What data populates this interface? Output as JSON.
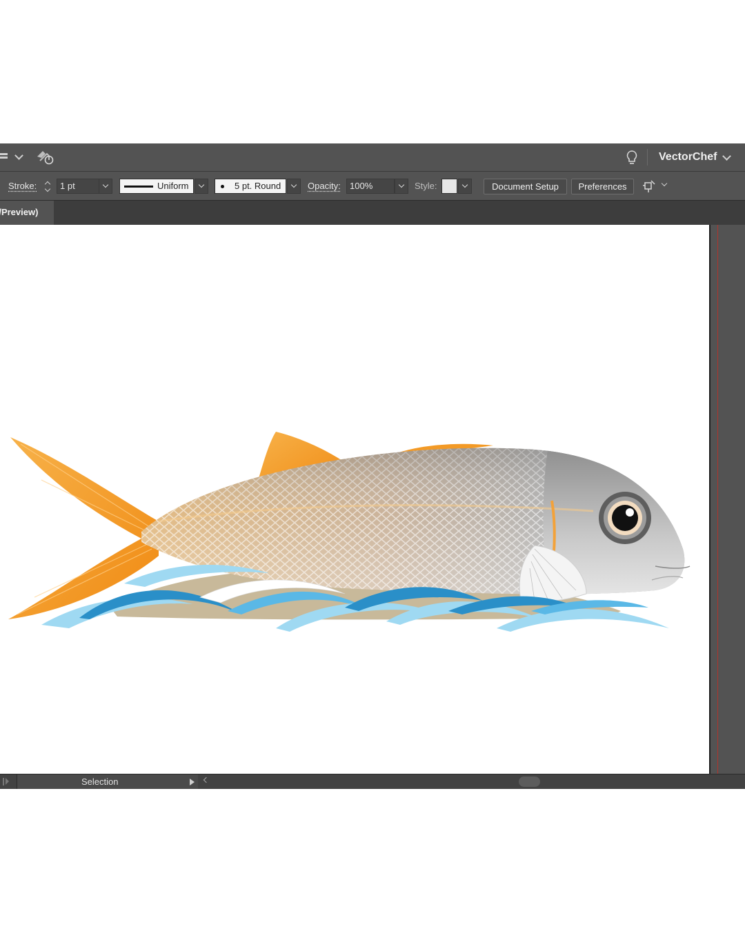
{
  "app": {
    "user_name": "VectorChef",
    "icons": {
      "workspace": "workspace-grid-icon",
      "sync": "cloud-sync-icon",
      "tip": "lightbulb-icon"
    }
  },
  "control_bar": {
    "stroke_label": "Stroke:",
    "stroke_weight": "1 pt",
    "profile_label": "Uniform",
    "brush_label": "5 pt. Round",
    "opacity_label": "Opacity:",
    "opacity_value": "100%",
    "style_label": "Style:",
    "document_setup": "Document Setup",
    "preferences": "Preferences"
  },
  "document_tab": {
    "label": "(/Preview)"
  },
  "status_bar": {
    "tool": "Selection"
  },
  "colors": {
    "ui_dark": "#323232",
    "ui_panel": "#535353",
    "fish_orange": "#f39a26",
    "fish_silver": "#9a9a9a",
    "water_blue": "#2a8fc8",
    "water_light": "#9fd9f2",
    "sand": "#c8b99a"
  }
}
